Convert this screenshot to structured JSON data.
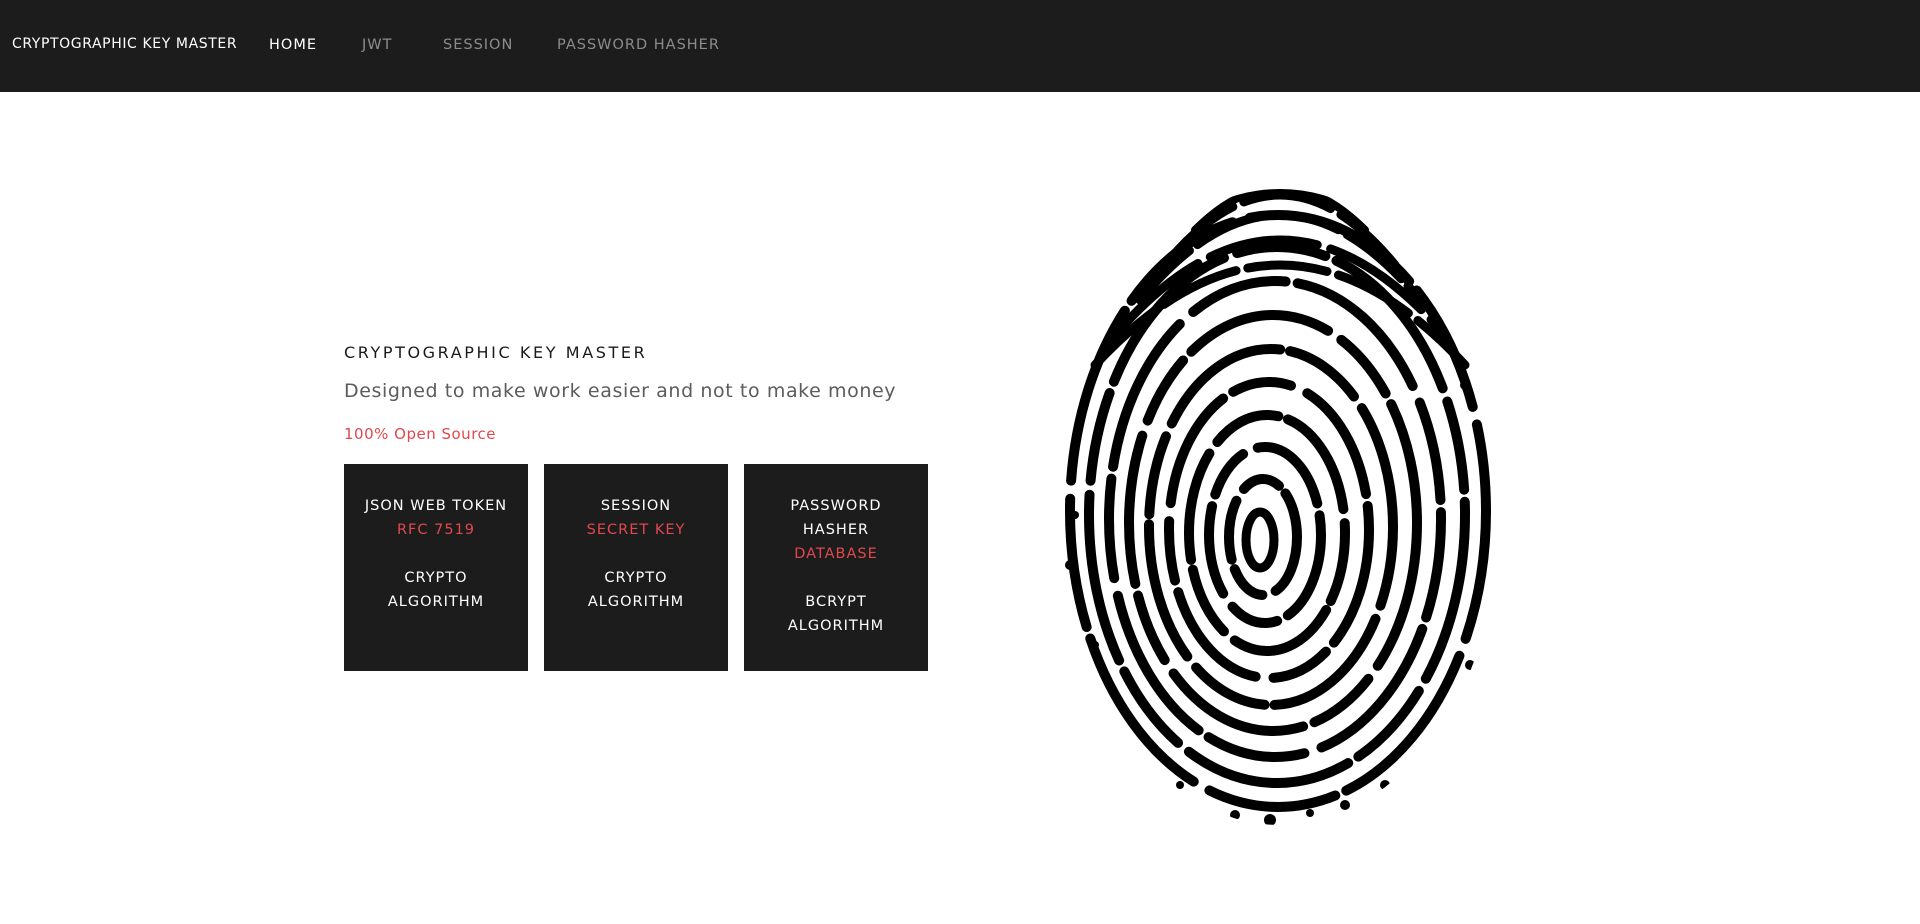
{
  "nav": {
    "brand": "CRYPTOGRAPHIC KEY MASTER",
    "links": [
      "HOME",
      "JWT",
      "SESSION",
      "PASSWORD HASHER"
    ],
    "active": "HOME"
  },
  "hero": {
    "title": "CRYPTOGRAPHIC KEY MASTER",
    "subtitle": "Designed to make work easier and not to make money",
    "badge": "100% Open Source"
  },
  "cards": [
    {
      "line1": "JSON WEB TOKEN",
      "red": "RFC 7519",
      "line3": "CRYPTO",
      "line4": "ALGORITHM"
    },
    {
      "line1": "SESSION",
      "red": "SECRET KEY",
      "line3": "CRYPTO",
      "line4": "ALGORITHM"
    },
    {
      "line1": "PASSWORD",
      "line2": "HASHER",
      "red": "DATABASE",
      "line3": "BCRYPT",
      "line4": "ALGORITHM"
    }
  ],
  "colors": {
    "navbar_bg": "#1c1c1c",
    "accent_red": "#e0484d",
    "card_bg": "#1c1c1c",
    "subtitle_gray": "#5c5c5c"
  },
  "icons": {
    "hero_graphic": "fingerprint-icon"
  }
}
